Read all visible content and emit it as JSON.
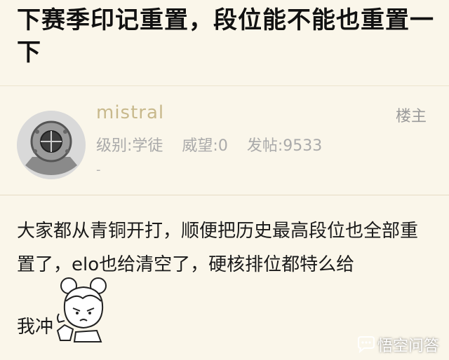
{
  "post": {
    "title": "下赛季印记重置，段位能不能也重置一下"
  },
  "author": {
    "username": "mistral",
    "floor_label": "楼主",
    "level": "级别:学徒",
    "prestige": "威望:0",
    "posts": "发帖:9533",
    "signature": "-"
  },
  "content": {
    "text": "大家都从青铜开打，顺便把历史最高段位也全部重置了，elo也给清空了，硬核排位都特么给",
    "last_line": "我冲"
  },
  "watermark": {
    "text": "悟空问答",
    "icon": "chat-bubble-icon"
  }
}
